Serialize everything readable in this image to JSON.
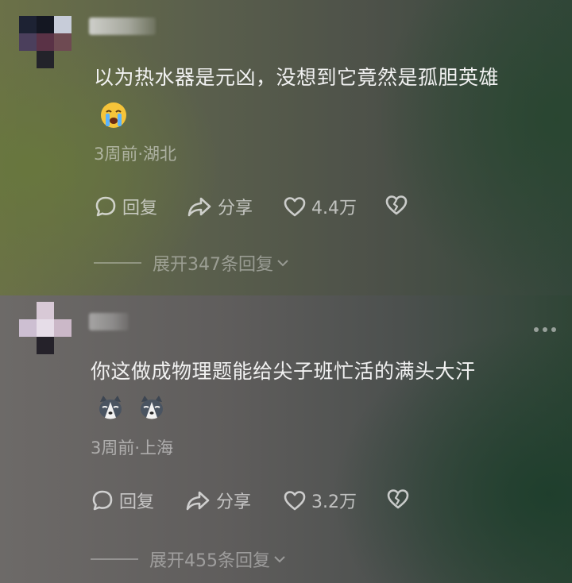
{
  "comments": [
    {
      "text": "以为热水器是元凶，没想到它竟然是孤胆英雄",
      "emoji": [
        "crying-face-icon"
      ],
      "meta": "3周前·湖北",
      "reply_label": "回复",
      "share_label": "分享",
      "likes": "4.4万",
      "expand_label": "展开347条回复"
    },
    {
      "text": "你这做成物理题能给尖子班忙活的满头大汗",
      "emoji": [
        "husky-dog-face-icon",
        "husky-dog-face-icon"
      ],
      "meta": "3周前·上海",
      "reply_label": "回复",
      "share_label": "分享",
      "likes": "3.2万",
      "expand_label": "展开455条回复"
    }
  ],
  "colors": {
    "text_primary": "#f1f1f1",
    "text_secondary": "rgba(235,235,235,0.55)"
  }
}
